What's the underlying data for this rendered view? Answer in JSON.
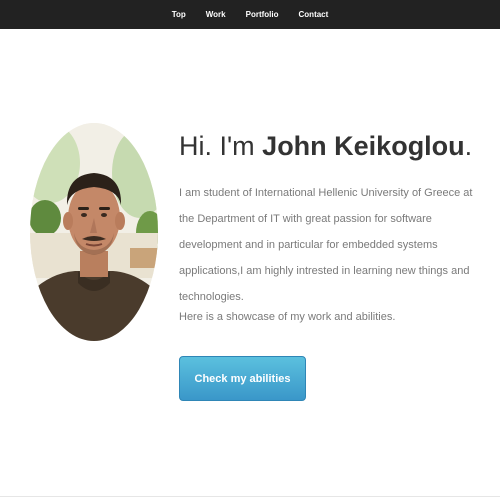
{
  "nav": {
    "items": [
      {
        "label": "Top"
      },
      {
        "label": "Work"
      },
      {
        "label": "Portfolio"
      },
      {
        "label": "Contact"
      }
    ]
  },
  "hero": {
    "greeting": "Hi. I'm",
    "name": "John Keikoglou",
    "period": ".",
    "bio": "I am student of International Hellenic University of Greece at the Department of IT with great passion for software development and in particular for embedded systems applications,I am highly intrested in learning new things and technologies.",
    "showcase": "Here is a showcase of my work and abilities.",
    "cta_label": "Check my abilities"
  },
  "colors": {
    "navbar": "#222222",
    "cta": "#3a97c9",
    "text": "#333333"
  }
}
